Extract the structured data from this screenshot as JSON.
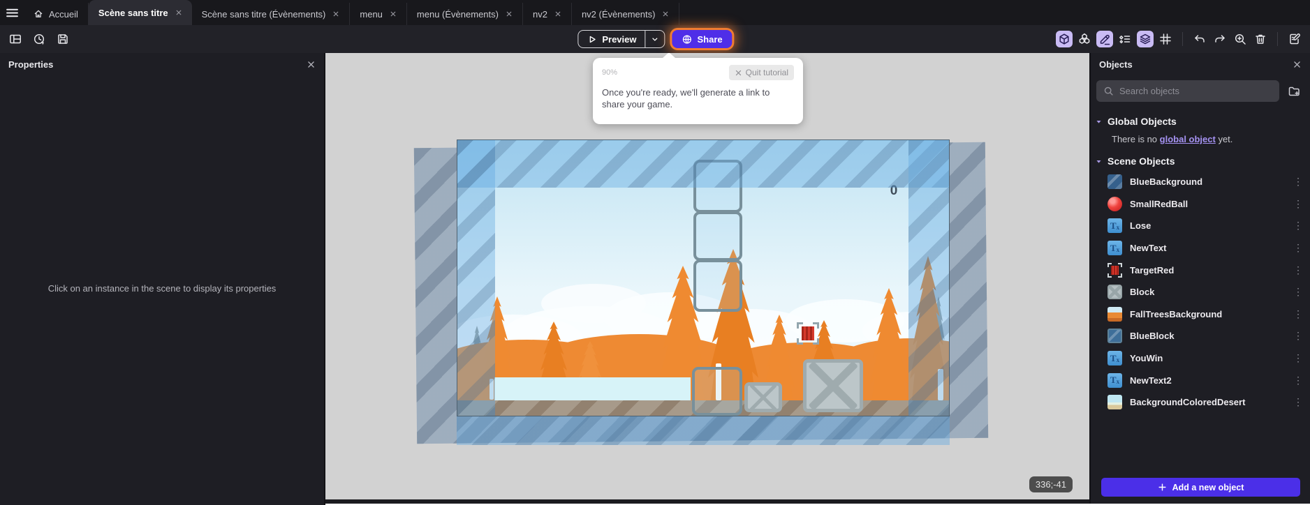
{
  "tab_bar": {
    "tabs": [
      {
        "id": "home",
        "label": "Accueil",
        "icon": "home",
        "closable": false,
        "active": false
      },
      {
        "id": "scene",
        "label": "Scène sans titre",
        "closable": true,
        "active": true
      },
      {
        "id": "scene-events",
        "label": "Scène sans titre (Évènements)",
        "closable": true,
        "active": false
      },
      {
        "id": "menu",
        "label": "menu",
        "closable": true,
        "active": false
      },
      {
        "id": "menu-events",
        "label": "menu (Évènements)",
        "closable": true,
        "active": false
      },
      {
        "id": "nv2",
        "label": "nv2",
        "closable": true,
        "active": false
      },
      {
        "id": "nv2-events",
        "label": "nv2 (Évènements)",
        "closable": true,
        "active": false
      }
    ]
  },
  "toolbar": {
    "preview_label": "Preview",
    "share_label": "Share",
    "left_icons": [
      {
        "name": "panels-layout-icon",
        "glyph": "panels"
      },
      {
        "name": "history-icon",
        "glyph": "history"
      },
      {
        "name": "save-icon",
        "glyph": "save"
      }
    ],
    "right_icons": [
      {
        "name": "objects-cube-icon",
        "glyph": "cube",
        "highlighted": true
      },
      {
        "name": "instances-cubes-icon",
        "glyph": "cubes",
        "highlighted": false
      },
      {
        "name": "edit-pencil-icon",
        "glyph": "pencil",
        "highlighted": true
      },
      {
        "name": "instances-list-icon",
        "glyph": "instlist",
        "highlighted": false
      },
      {
        "name": "layers-icon",
        "glyph": "layers",
        "highlighted": true
      },
      {
        "name": "grid-icon",
        "glyph": "grid",
        "highlighted": false
      },
      {
        "divider": true
      },
      {
        "name": "undo-icon",
        "glyph": "undo",
        "highlighted": false
      },
      {
        "name": "redo-icon",
        "glyph": "redo",
        "highlighted": false
      },
      {
        "name": "zoom-in-icon",
        "glyph": "zoomin",
        "highlighted": false
      },
      {
        "name": "trash-icon",
        "glyph": "trash",
        "highlighted": false
      },
      {
        "divider": true
      },
      {
        "name": "scene-notes-icon",
        "glyph": "noteedit",
        "highlighted": false
      }
    ]
  },
  "properties_panel": {
    "title": "Properties",
    "empty_message": "Click on an instance in the scene to display its properties"
  },
  "tutorial_tooltip": {
    "progress": "90%",
    "quit_label": "Quit tutorial",
    "message": "Once you're ready, we'll generate a link to share your game."
  },
  "scene_canvas": {
    "score_text": "0",
    "cursor_coordinates": "336;-41"
  },
  "objects_panel": {
    "title": "Objects",
    "search_placeholder": "Search objects",
    "global_section": {
      "label": "Global Objects",
      "empty_text_prefix": "There is no ",
      "empty_link_text": "global object",
      "empty_text_suffix": " yet."
    },
    "scene_section": {
      "label": "Scene Objects",
      "objects": [
        {
          "name": "BlueBackground",
          "icon": "blue-diag"
        },
        {
          "name": "SmallRedBall",
          "icon": "red-ball"
        },
        {
          "name": "Lose",
          "icon": "text"
        },
        {
          "name": "NewText",
          "icon": "text"
        },
        {
          "name": "TargetRed",
          "icon": "target"
        },
        {
          "name": "Block",
          "icon": "crate"
        },
        {
          "name": "FallTreesBackground",
          "icon": "fall-trees"
        },
        {
          "name": "BlueBlock",
          "icon": "blue-block"
        },
        {
          "name": "YouWin",
          "icon": "text"
        },
        {
          "name": "NewText2",
          "icon": "text"
        },
        {
          "name": "BackgroundColoredDesert",
          "icon": "desert"
        }
      ]
    },
    "add_button_label": "Add a new object"
  },
  "colors": {
    "accent_purple": "#4f2ee8",
    "toolbar_highlight_lavender": "#c9bbf4",
    "share_glow_orange": "#f68030",
    "link_purple": "#a592f2",
    "canvas_gray": "#d2d2d2"
  }
}
